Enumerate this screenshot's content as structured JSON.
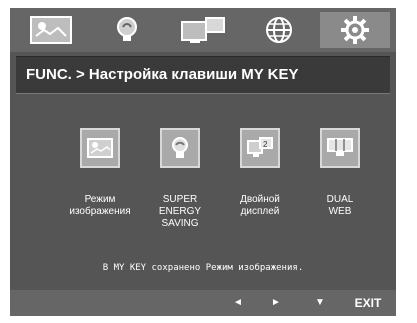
{
  "tabs": [
    {
      "icon": "picture-icon",
      "active": false
    },
    {
      "icon": "bulb-icon",
      "active": false
    },
    {
      "icon": "dual-display-icon",
      "active": false
    },
    {
      "icon": "globe-icon",
      "active": false
    },
    {
      "icon": "gear-icon",
      "active": true
    }
  ],
  "title": "FUNC.  >  Настройка клавиши MY KEY",
  "items": [
    {
      "icon": "picture-mode-icon",
      "label": "Режим\nизображения"
    },
    {
      "icon": "bulb-icon",
      "label": "SUPER\nENERGY\nSAVING"
    },
    {
      "icon": "dual-display-icon",
      "label": "Двойной\nдисплей"
    },
    {
      "icon": "dual-web-icon",
      "label": "DUAL\nWEB"
    }
  ],
  "status": "В MY KEY сохранено Режим изображения.",
  "bottom": {
    "left": "◄",
    "right": "►",
    "down": "▼",
    "exit": "EXIT"
  }
}
